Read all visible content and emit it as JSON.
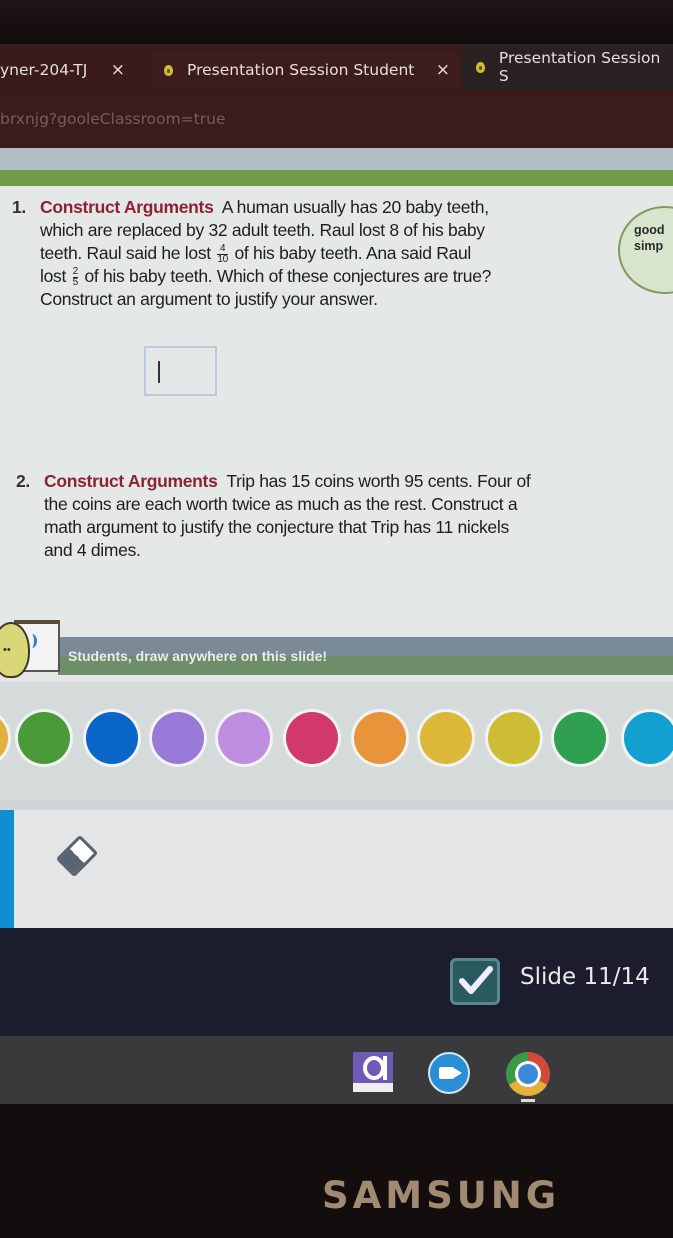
{
  "browser": {
    "tabs": [
      {
        "label": "yner-204-TJ",
        "close": "×",
        "active": false
      },
      {
        "label": "Presentation Session Student",
        "close": "×",
        "active": true
      },
      {
        "label": "Presentation Session S",
        "active": false
      }
    ],
    "url": "brxnjg?gooleClassroom=true"
  },
  "slide": {
    "questions": [
      {
        "number": "1.",
        "lead": "Construct Arguments",
        "lines": [
          "A human usually has 20 baby teeth,",
          "which are replaced by 32 adult teeth. Raul lost 8 of his baby",
          [
            "teeth. Raul said he lost ",
            "of his baby teeth. Ana said Raul"
          ],
          [
            "lost ",
            "of his baby teeth. Which of these conjectures are true?"
          ],
          "Construct an argument to justify your answer."
        ],
        "fractions": [
          {
            "num": "4",
            "den": "10"
          },
          {
            "num": "2",
            "den": "5"
          }
        ]
      },
      {
        "number": "2.",
        "lead": "Construct Arguments",
        "lines": [
          "Trip has 15 coins worth 95 cents. Four of",
          "the coins are each worth twice as much as the rest. Construct a",
          "math argument to justify the conjecture that Trip has 11 nickels",
          "and 4 dimes."
        ]
      }
    ],
    "answer_box_value": "",
    "sticky_note": [
      "good",
      "simp"
    ]
  },
  "banner": {
    "text": "Students, draw anywhere on this slide!"
  },
  "palette": {
    "colors": [
      "#4a9a3a",
      "#0a66c8",
      "#9a7ad8",
      "#c08ee0",
      "#d0396a",
      "#e8943a",
      "#dcb83a",
      "#cdbd35",
      "#2fa050",
      "#13a0d0"
    ]
  },
  "tools": {
    "eraser": "eraser-icon"
  },
  "status": {
    "slide_label": "Slide 11/14"
  },
  "shelf": {
    "apps": [
      "a-app-icon",
      "zoom-icon",
      "chrome-icon"
    ]
  },
  "device": {
    "brand": "SAMSUNG"
  }
}
